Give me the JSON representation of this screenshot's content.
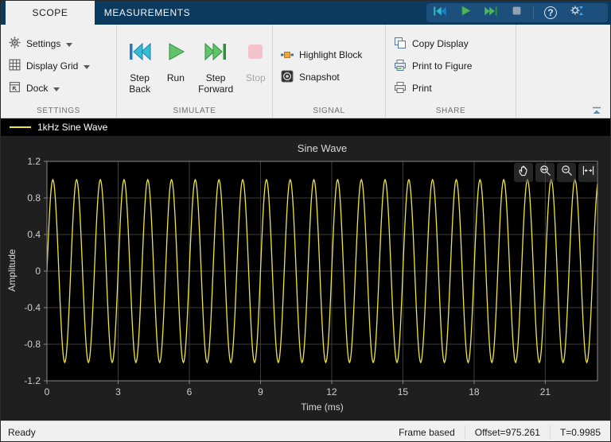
{
  "tabs": {
    "scope": "SCOPE",
    "measurements": "MEASUREMENTS"
  },
  "quick_toolbar": {
    "help_glyph": "?"
  },
  "ribbon": {
    "settings": {
      "label": "SETTINGS",
      "items": [
        {
          "label": "Settings",
          "icon": "gear-icon",
          "dropdown": true
        },
        {
          "label": "Display Grid",
          "icon": "grid-icon",
          "dropdown": true
        },
        {
          "label": "Dock",
          "icon": "dock-icon",
          "dropdown": true
        }
      ]
    },
    "simulate": {
      "label": "SIMULATE",
      "step_back": "Step Back",
      "run": "Run",
      "step_forward": "Step Forward",
      "stop": "Stop",
      "stop_enabled": false
    },
    "signal": {
      "label": "SIGNAL",
      "highlight_block": "Highlight Block",
      "snapshot": "Snapshot"
    },
    "share": {
      "label": "SHARE",
      "copy_display": "Copy Display",
      "print_to_figure": "Print to Figure",
      "print": "Print"
    }
  },
  "legend": {
    "series": "1kHz Sine Wave",
    "color": "#f0e442"
  },
  "chart_data": {
    "type": "line",
    "title": "Sine Wave",
    "xlabel": "Time (ms)",
    "ylabel": "Amplitude",
    "xlim": [
      0,
      23.2
    ],
    "ylim": [
      -1.2,
      1.2
    ],
    "xticks": [
      0,
      3,
      6,
      9,
      12,
      15,
      18,
      21
    ],
    "yticks": [
      -1.2,
      -0.8,
      -0.4,
      0,
      0.4,
      0.8,
      1.2
    ],
    "grid": true,
    "legend_position": "top-strip",
    "background": "#000000",
    "series": [
      {
        "name": "1kHz Sine Wave",
        "color": "#f0e442",
        "waveform": "sine",
        "amplitude": 1.0,
        "frequency_per_ms": 1.0,
        "phase": 0
      }
    ]
  },
  "status": {
    "ready": "Ready",
    "frame_mode": "Frame based",
    "offset": "Offset=975.261",
    "time": "T=0.9985"
  }
}
